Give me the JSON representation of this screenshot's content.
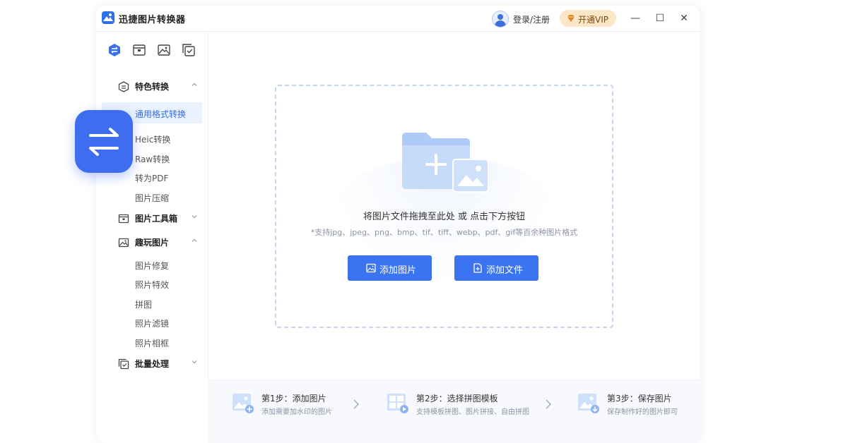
{
  "app": {
    "title": "迅捷图片转换器",
    "accent_color": "#2f6fe8"
  },
  "header": {
    "login_label": "登录/注册",
    "vip_label": "开通VIP",
    "avatar_icon": "user-avatar-icon",
    "window_controls": {
      "minimize": "—",
      "maximize": "☐",
      "close": "✕"
    }
  },
  "sidebar": {
    "top_icons": [
      "convert-icon",
      "toolbox-icon",
      "image-icon",
      "batch-icon"
    ],
    "groups": [
      {
        "label": "特色转换",
        "icon": "convert-icon",
        "expanded": true,
        "items": [
          "通用格式转换",
          "Heic转换",
          "Raw转换",
          "转为PDF",
          "图片压缩"
        ],
        "active_item": "通用格式转换"
      },
      {
        "label": "图片工具箱",
        "icon": "toolbox-icon",
        "expanded": false,
        "items": []
      },
      {
        "label": "趣玩图片",
        "icon": "image-icon",
        "expanded": true,
        "items": [
          "图片修复",
          "照片特效",
          "拼图",
          "照片滤镜",
          "照片相框"
        ]
      },
      {
        "label": "批量处理",
        "icon": "batch-icon",
        "expanded": false,
        "items": []
      }
    ]
  },
  "float_badge": {
    "icon": "swap-arrows-icon"
  },
  "dropzone": {
    "title": "将图片文件拖拽至此处 或 点击下方按钮",
    "hint": "*支持jpg、jpeg、png、bmp、tif、tiff、webp、pdf、gif等百余种图片格式",
    "buttons": [
      {
        "label": "添加图片",
        "icon": "image-icon"
      },
      {
        "label": "添加文件",
        "icon": "file-add-icon"
      }
    ]
  },
  "steps": [
    {
      "title": "第1步：添加图片",
      "desc": "添加需要加水印的图片"
    },
    {
      "title": "第2步：选择拼图模板",
      "desc": "支持模板拼图、图片拼接、自由拼图"
    },
    {
      "title": "第3步：保存图片",
      "desc": "保存制作好的图片即可"
    }
  ]
}
